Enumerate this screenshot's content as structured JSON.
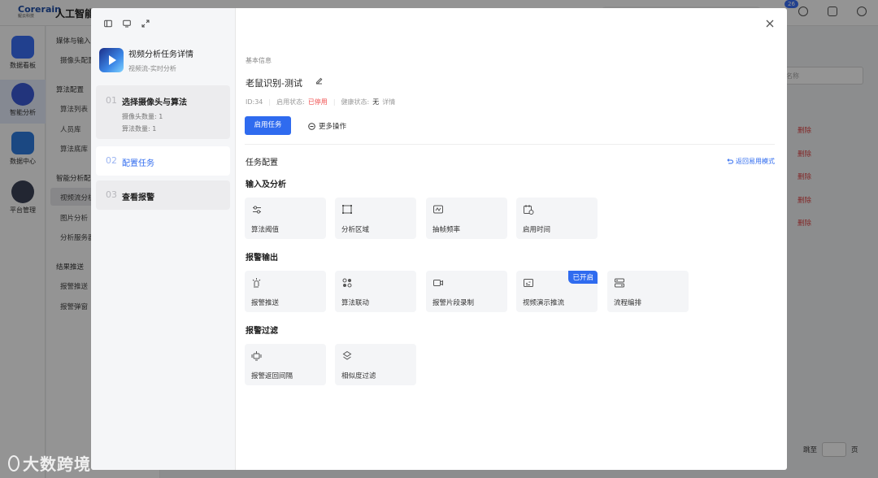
{
  "background": {
    "logo": {
      "brand": "Corerain",
      "sub": "鲲云科技"
    },
    "app_title": "人工智能",
    "notif_count": "26",
    "rail": [
      {
        "label": "数据看板",
        "color": "#3a6ff5"
      },
      {
        "label": "智能分析",
        "color": "#3b5bd6"
      },
      {
        "label": "数据中心",
        "color": "#2f7de0"
      },
      {
        "label": "平台管理",
        "color": "#3b4256"
      }
    ],
    "subnav": [
      {
        "type": "group",
        "label": "媒体与输入"
      },
      {
        "type": "item",
        "label": "摄像头配置"
      },
      {
        "type": "group",
        "label": "算法配置"
      },
      {
        "type": "item",
        "label": "算法列表"
      },
      {
        "type": "item",
        "label": "人员库"
      },
      {
        "type": "item",
        "label": "算法底库"
      },
      {
        "type": "group",
        "label": "智能分析配置"
      },
      {
        "type": "item",
        "label": "视频流分析"
      },
      {
        "type": "item",
        "label": "图片分析"
      },
      {
        "type": "item",
        "label": "分析服务器"
      },
      {
        "type": "group",
        "label": "结果推送"
      },
      {
        "type": "item",
        "label": "报警推送"
      },
      {
        "type": "item",
        "label": "报警弹窗"
      }
    ],
    "search_placeholder": "名称",
    "delete_label": "删除",
    "pager": {
      "goto": "跳至",
      "page": "页"
    }
  },
  "modal": {
    "task": {
      "title": "视频分析任务详情",
      "subtitle": "视频流-实时分析"
    },
    "steps": [
      {
        "num": "01",
        "title": "选择摄像头与算法",
        "meta": [
          "摄像头数量: 1",
          "算法数量: 1"
        ]
      },
      {
        "num": "02",
        "title": "配置任务",
        "meta": []
      },
      {
        "num": "03",
        "title": "查看报警",
        "meta": []
      }
    ],
    "basic": {
      "section_label": "基本信息",
      "name": "老鼠识别-测试",
      "id": "ID:34",
      "status_label": "启用状态:",
      "status_value": "已停用",
      "health_label": "健康状态:",
      "health_value": "无",
      "detail_link": "详情",
      "enable_button": "启用任务",
      "more_button": "更多操作"
    },
    "config": {
      "title": "任务配置",
      "simple_mode_link": "返回易用模式",
      "groups": [
        {
          "title": "输入及分析",
          "cards": [
            {
              "label": "算法阈值",
              "icon": "sliders-icon"
            },
            {
              "label": "分析区域",
              "icon": "roi-icon"
            },
            {
              "label": "抽帧频率",
              "icon": "frame-rate-icon"
            },
            {
              "label": "启用时间",
              "icon": "schedule-icon"
            }
          ]
        },
        {
          "title": "报警输出",
          "cards": [
            {
              "label": "报警推送",
              "icon": "alarm-push-icon"
            },
            {
              "label": "算法联动",
              "icon": "linkage-icon"
            },
            {
              "label": "报警片段录制",
              "icon": "video-record-icon"
            },
            {
              "label": "视频演示推流",
              "icon": "stream-icon",
              "badge": "已开启"
            },
            {
              "label": "流程编排",
              "icon": "workflow-icon"
            }
          ]
        },
        {
          "title": "报警过滤",
          "cards": [
            {
              "label": "报警返回间隔",
              "icon": "interval-icon"
            },
            {
              "label": "相似度过滤",
              "icon": "similarity-icon"
            }
          ]
        }
      ]
    }
  },
  "watermark": "大数跨境"
}
